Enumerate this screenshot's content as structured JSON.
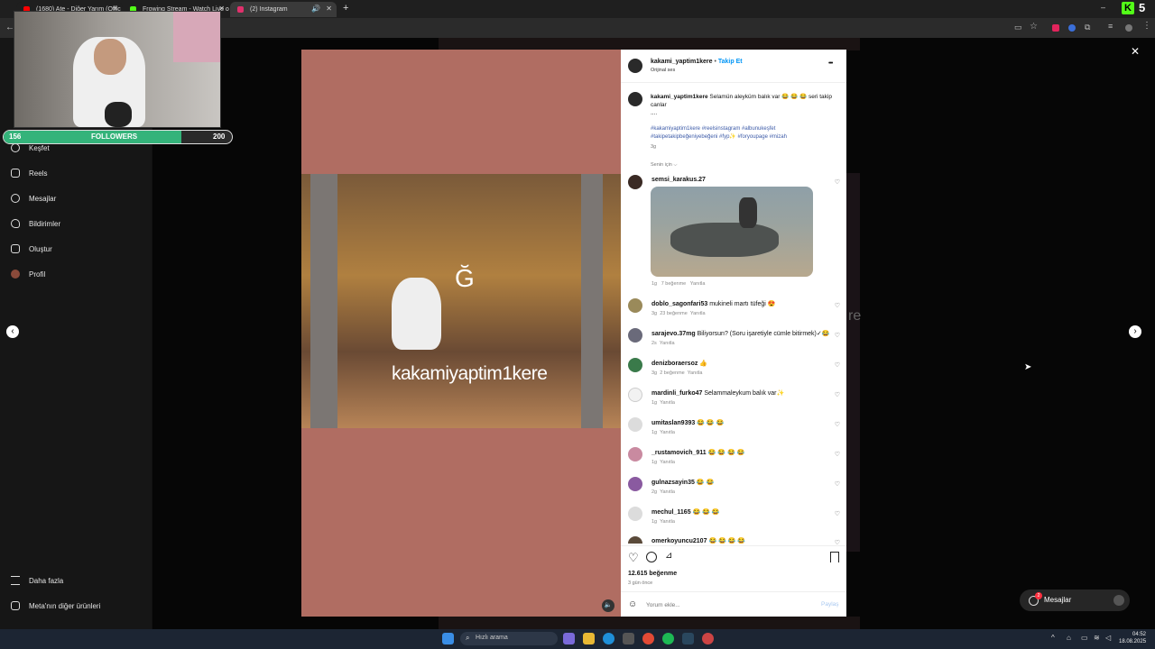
{
  "browser": {
    "tabs": [
      {
        "label": "(1680) Ate - Diğer Yarım (Offic",
        "color": "#ff0000"
      },
      {
        "label": "Frowing Stream - Watch Live o",
        "color": "#53fc18"
      },
      {
        "label": "(2) Instagram",
        "color": "#e1306c"
      }
    ],
    "new_tab": "+"
  },
  "sidebar": {
    "items": [
      {
        "label": "Keşfet",
        "icon": "compass-icon"
      },
      {
        "label": "Reels",
        "icon": "reels-icon"
      },
      {
        "label": "Mesajlar",
        "icon": "messenger-icon"
      },
      {
        "label": "Bildirimler",
        "icon": "heart-icon"
      },
      {
        "label": "Oluştur",
        "icon": "plus-icon"
      },
      {
        "label": "Profil",
        "icon": "profile-icon"
      }
    ],
    "more": "Daha fazla",
    "meta": "Meta'nın diğer ürünleri"
  },
  "webcam": {
    "followers_current": "156",
    "followers_label": "FOLLOWERS",
    "followers_goal": "200",
    "progress": 0.78,
    "brand_letter": "5"
  },
  "video": {
    "caption_letter": "Ğ",
    "watermark": "kakamiyaptim1kere"
  },
  "post": {
    "author": "kakami_yaptim1kere",
    "follow": "Takip Et",
    "audio": "Orijinal ses",
    "caption_user": "kakami_yaptim1kere",
    "caption_text": "Selamün aleyküm balık var 😂 😂 😂 seri takip",
    "caption_text2": "canlar",
    "caption_dots": "....",
    "hashtags1": "#kakamiyaptim1kere #reelsinstagram #albunukeşfet",
    "hashtags2": "#takipetakipbeğeniyebeğeni #fyp✨ #foryoupage #mizah",
    "caption_time": "3g",
    "for_you": "Senin için ⌵",
    "likes": "12.615 beğenme",
    "posted": "3 gün önce",
    "comment_placeholder": "Yorum ekle...",
    "share": "Paylaş",
    "more_icon": "•••"
  },
  "comments": [
    {
      "user": "semsi_karakus.27",
      "text": "",
      "time": "1g",
      "likes": "7 beğenme",
      "reply": "Yanıtla",
      "has_image": true
    },
    {
      "user": "doblo_sagonfari53",
      "text": "mukineli martı tüfeği 😍",
      "time": "3g",
      "likes": "23 beğenme",
      "reply": "Yanıtla"
    },
    {
      "user": "sarajevo.37mg",
      "text": "Biliyorsun? (Soru işaretiyle cümle bitirmek)✓😂",
      "time": "2s",
      "likes": "",
      "reply": "Yanıtla"
    },
    {
      "user": "denizboraersoz",
      "text": "👍",
      "time": "3g",
      "likes": "2 beğenme",
      "reply": "Yanıtla"
    },
    {
      "user": "mardinli_furko47",
      "text": "Selammaleykum balık var✨",
      "time": "1g",
      "likes": "",
      "reply": "Yanıtla"
    },
    {
      "user": "umitaslan9393",
      "text": "😂 😂 😂",
      "time": "1g",
      "likes": "",
      "reply": "Yanıtla"
    },
    {
      "user": "_rustamovich_911",
      "text": "😂 😂 😂 😂",
      "time": "1g",
      "likes": "",
      "reply": "Yanıtla"
    },
    {
      "user": "gulnazsayin35",
      "text": "😂 😂",
      "time": "2g",
      "likes": "",
      "reply": "Yanıtla"
    },
    {
      "user": "mechul_1165",
      "text": "😂 😂 😂",
      "time": "1g",
      "likes": "",
      "reply": "Yanıtla"
    },
    {
      "user": "omerkoyuncu2107",
      "text": "😂 😂 😂 😂",
      "time": "",
      "likes": "",
      "reply": ""
    }
  ],
  "messages_widget": {
    "label": "Mesajlar",
    "badge": "2"
  },
  "taskbar": {
    "search": "Hızlı arama",
    "time": "04:52",
    "date": "18.08.2025"
  }
}
